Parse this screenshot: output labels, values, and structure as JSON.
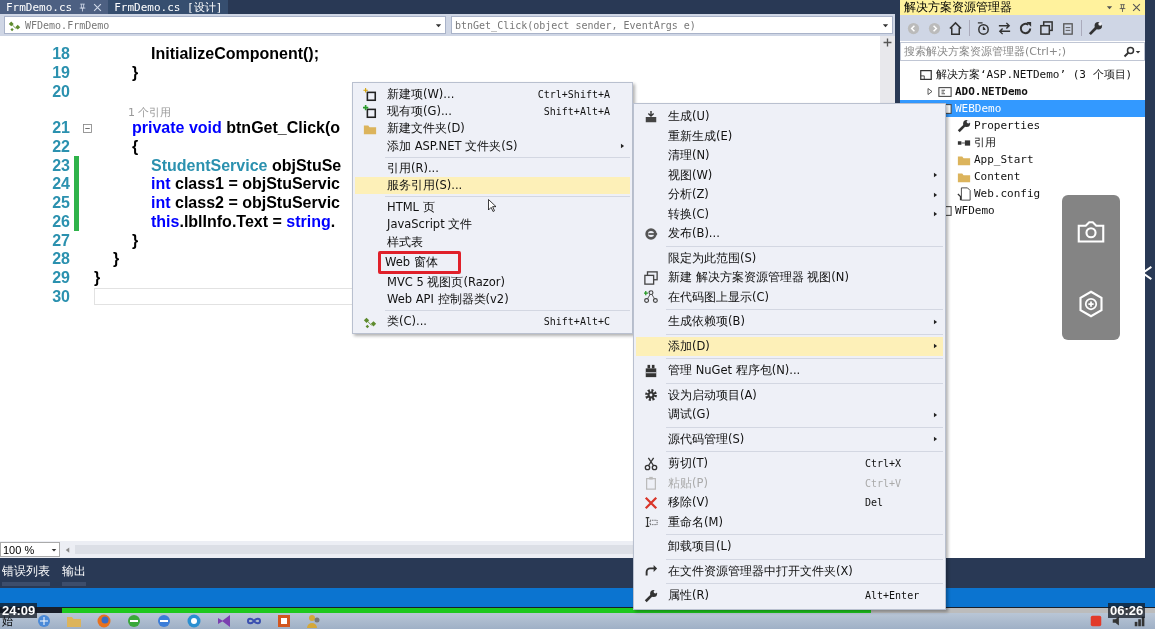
{
  "editor": {
    "tabs": [
      {
        "label": "FrmDemo.cs",
        "selected": true
      },
      {
        "label": "FrmDemo.cs [设计]",
        "selected": false
      }
    ],
    "type_dropdown": "WFDemo.FrmDemo",
    "member_dropdown": "btnGet_Click(object sender, EventArgs e)",
    "lines": [
      {
        "kind": "code",
        "number": "18",
        "changed": false,
        "foldable": false,
        "current": false,
        "tokens": [
          {
            "kind": "plain",
            "text": "            InitializeComponent();"
          }
        ]
      },
      {
        "kind": "code",
        "number": "19",
        "changed": false,
        "foldable": false,
        "current": false,
        "tokens": [
          {
            "kind": "plain",
            "text": "        }"
          }
        ]
      },
      {
        "kind": "code",
        "number": "20",
        "changed": false,
        "foldable": false,
        "current": false
      },
      {
        "kind": "lens",
        "text": "        1 个引用"
      },
      {
        "kind": "code",
        "number": "21",
        "changed": false,
        "foldable": true,
        "current": false,
        "tokens": [
          {
            "kind": "keyword",
            "text": "        private void"
          },
          {
            "kind": "plain",
            "text": " btnGet_Click(o"
          }
        ]
      },
      {
        "kind": "code",
        "number": "22",
        "changed": false,
        "foldable": false,
        "current": false,
        "tokens": [
          {
            "kind": "plain",
            "text": "        {"
          }
        ]
      },
      {
        "kind": "code",
        "number": "23",
        "changed": true,
        "foldable": false,
        "current": false,
        "tokens": [
          {
            "kind": "type",
            "text": "            StudentService"
          },
          {
            "kind": "plain",
            "text": " objStuSe"
          }
        ]
      },
      {
        "kind": "code",
        "number": "24",
        "changed": true,
        "foldable": false,
        "current": false,
        "tokens": [
          {
            "kind": "keyword",
            "text": "            int"
          },
          {
            "kind": "plain",
            "text": " class1 = objStuServic"
          }
        ]
      },
      {
        "kind": "code",
        "number": "25",
        "changed": true,
        "foldable": false,
        "current": false,
        "tokens": [
          {
            "kind": "keyword",
            "text": "            int"
          },
          {
            "kind": "plain",
            "text": " class2 = objStuServic"
          }
        ]
      },
      {
        "kind": "code",
        "number": "26",
        "changed": true,
        "foldable": false,
        "current": false,
        "tokens": [
          {
            "kind": "keyword",
            "text": "            this"
          },
          {
            "kind": "plain",
            "text": ".lblInfo.Text = "
          },
          {
            "kind": "keyword",
            "text": "string"
          },
          {
            "kind": "plain",
            "text": "."
          }
        ]
      },
      {
        "kind": "code",
        "number": "27",
        "changed": false,
        "foldable": false,
        "current": false,
        "tokens": [
          {
            "kind": "plain",
            "text": "        }"
          }
        ]
      },
      {
        "kind": "code",
        "number": "28",
        "changed": false,
        "foldable": false,
        "current": false,
        "tokens": [
          {
            "kind": "plain",
            "text": "    }"
          }
        ]
      },
      {
        "kind": "code",
        "number": "29",
        "changed": false,
        "foldable": false,
        "current": false,
        "tokens": [
          {
            "kind": "plain",
            "text": "}"
          }
        ]
      },
      {
        "kind": "code",
        "number": "30",
        "changed": false,
        "foldable": false,
        "current": true
      }
    ],
    "zoom": "100 %"
  },
  "solution_explorer": {
    "title": "解决方案资源管理器",
    "search": {
      "placeholder": "搜索解决方案资源管理器(Ctrl+;)"
    },
    "tree": [
      {
        "kind": "solution",
        "label": "解决方案‘ASP.NETDemo’ (3 个项目)",
        "selected": false,
        "children": [
          {
            "kind": "project",
            "label": "ADO.NETDemo",
            "startup": true,
            "expanded": false,
            "selected": false
          },
          {
            "kind": "project",
            "label": "WEBDemo",
            "startup": false,
            "selected": true,
            "children": [
              {
                "kind": "properties",
                "label": "Properties",
                "selected": false
              },
              {
                "kind": "references",
                "label": "引用",
                "selected": false
              },
              {
                "kind": "folder",
                "label": "App_Start",
                "selected": false
              },
              {
                "kind": "folder",
                "label": "Content",
                "selected": false
              },
              {
                "kind": "file",
                "label": "Web.config",
                "selected": false
              }
            ]
          },
          {
            "kind": "project",
            "label": "WFDemo",
            "startup": false,
            "selected": false
          }
        ]
      }
    ]
  },
  "add_menu": {
    "groups": [
      {
        "items": [
          {
            "label": "新建项(W)...",
            "shortcut": "Ctrl+Shift+A",
            "submenu": false,
            "selected": false,
            "outlined": false
          },
          {
            "label": "现有项(G)...",
            "shortcut": "Shift+Alt+A",
            "submenu": false,
            "selected": false,
            "outlined": false
          },
          {
            "label": "新建文件夹(D)",
            "submenu": false,
            "selected": false,
            "outlined": false
          },
          {
            "label": "添加 ASP.NET 文件夹(S)",
            "submenu": true,
            "selected": false,
            "outlined": false
          }
        ]
      },
      {
        "items": [
          {
            "label": "引用(R)...",
            "submenu": false,
            "selected": false,
            "outlined": false
          },
          {
            "label": "服务引用(S)...",
            "submenu": false,
            "selected": true,
            "outlined": false
          }
        ]
      },
      {
        "items": [
          {
            "label": "HTML 页",
            "submenu": false,
            "selected": false,
            "outlined": false
          },
          {
            "label": "JavaScript 文件",
            "submenu": false,
            "selected": false,
            "outlined": false
          },
          {
            "label": "样式表",
            "submenu": false,
            "selected": false,
            "outlined": false
          },
          {
            "label": "Web 窗体",
            "submenu": false,
            "selected": false,
            "outlined": true
          },
          {
            "label": "MVC 5 视图页(Razor)",
            "submenu": false,
            "selected": false,
            "outlined": false
          },
          {
            "label": "Web API 控制器类(v2)",
            "submenu": false,
            "selected": false,
            "outlined": false
          }
        ]
      },
      {
        "items": [
          {
            "label": "类(C)...",
            "shortcut": "Shift+Alt+C",
            "submenu": false,
            "selected": false,
            "outlined": false
          }
        ]
      }
    ]
  },
  "project_menu": {
    "groups": [
      {
        "items": [
          {
            "label": "生成(U)",
            "submenu": false,
            "selected": false,
            "disabled": false
          },
          {
            "label": "重新生成(E)",
            "submenu": false,
            "selected": false,
            "disabled": false
          },
          {
            "label": "清理(N)",
            "submenu": false,
            "selected": false,
            "disabled": false
          },
          {
            "label": "视图(W)",
            "submenu": true,
            "selected": false,
            "disabled": false
          },
          {
            "label": "分析(Z)",
            "submenu": true,
            "selected": false,
            "disabled": false
          },
          {
            "label": "转换(C)",
            "submenu": true,
            "selected": false,
            "disabled": false
          },
          {
            "label": "发布(B)...",
            "submenu": false,
            "selected": false,
            "disabled": false
          }
        ]
      },
      {
        "items": [
          {
            "label": "限定为此范围(S)",
            "submenu": false,
            "selected": false,
            "disabled": false
          },
          {
            "label": "新建 解决方案资源管理器 视图(N)",
            "submenu": false,
            "selected": false,
            "disabled": false
          },
          {
            "label": "在代码图上显示(C)",
            "submenu": false,
            "selected": false,
            "disabled": false
          }
        ]
      },
      {
        "items": [
          {
            "label": "生成依赖项(B)",
            "submenu": true,
            "selected": false,
            "disabled": false
          }
        ]
      },
      {
        "items": [
          {
            "label": "添加(D)",
            "submenu": true,
            "selected": true,
            "disabled": false
          }
        ]
      },
      {
        "items": [
          {
            "label": "管理 NuGet 程序包(N)...",
            "submenu": false,
            "selected": false,
            "disabled": false
          }
        ]
      },
      {
        "items": [
          {
            "label": "设为启动项目(A)",
            "submenu": false,
            "selected": false,
            "disabled": false
          },
          {
            "label": "调试(G)",
            "submenu": true,
            "selected": false,
            "disabled": false
          }
        ]
      },
      {
        "items": [
          {
            "label": "源代码管理(S)",
            "submenu": true,
            "selected": false,
            "disabled": false
          }
        ]
      },
      {
        "items": [
          {
            "label": "剪切(T)",
            "shortcut": "Ctrl+X",
            "submenu": false,
            "selected": false,
            "disabled": false
          },
          {
            "label": "粘贴(P)",
            "shortcut": "Ctrl+V",
            "submenu": false,
            "selected": false,
            "disabled": true
          },
          {
            "label": "移除(V)",
            "shortcut": "Del",
            "submenu": false,
            "selected": false,
            "disabled": false
          },
          {
            "label": "重命名(M)",
            "submenu": false,
            "selected": false,
            "disabled": false
          }
        ]
      },
      {
        "items": [
          {
            "label": "卸载项目(L)",
            "submenu": false,
            "selected": false,
            "disabled": false
          }
        ]
      },
      {
        "items": [
          {
            "label": "在文件资源管理器中打开文件夹(X)",
            "submenu": false,
            "selected": false,
            "disabled": false
          }
        ]
      },
      {
        "items": [
          {
            "label": "属性(R)",
            "shortcut": "Alt+Enter",
            "submenu": false,
            "selected": false,
            "disabled": false
          }
        ]
      }
    ]
  },
  "output_tabs": [
    "错误列表",
    "输出"
  ],
  "player": {
    "elapsed": "24:09",
    "remaining": "06:26",
    "level": 0.74
  },
  "taskbar": {
    "start_label": "始"
  }
}
